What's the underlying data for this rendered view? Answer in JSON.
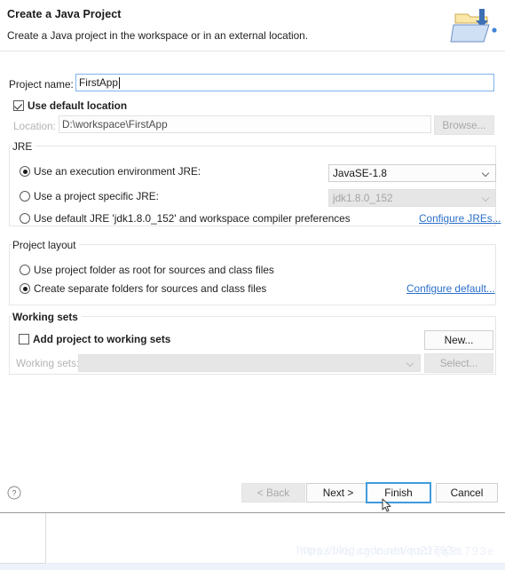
{
  "header": {
    "title": "Create a Java Project",
    "subtitle": "Create a Java project in the workspace or in an external location.",
    "icon": "new-java-project-icon"
  },
  "project": {
    "name_label": "Project name:",
    "name_value": "FirstApp",
    "name_placeholder": "",
    "use_default_location_label": "Use default location",
    "use_default_location_checked": true,
    "location_label": "Location:",
    "location_value": "D:\\workspace\\FirstApp",
    "browse_label": "Browse..."
  },
  "jre": {
    "group_label": "JRE",
    "options": [
      {
        "label": "Use an execution environment JRE:",
        "selected": true
      },
      {
        "label": "Use a project specific JRE:",
        "selected": false
      },
      {
        "label": "Use default JRE 'jdk1.8.0_152' and workspace compiler preferences",
        "selected": false
      }
    ],
    "execution_environment_value": "JavaSE-1.8",
    "project_specific_value": "jdk1.8.0_152",
    "configure_link": "Configure JREs..."
  },
  "project_layout": {
    "group_label": "Project layout",
    "options": [
      {
        "label": "Use project folder as root for sources and class files",
        "selected": false
      },
      {
        "label": "Create separate folders for sources and class files",
        "selected": true
      }
    ],
    "configure_link": "Configure default..."
  },
  "working_sets": {
    "group_label": "Working sets",
    "add_label": "Add project to working sets",
    "add_checked": false,
    "sets_label": "Working sets:",
    "sets_value": "",
    "new_label": "New...",
    "select_label": "Select..."
  },
  "footer": {
    "help_icon": "help-icon",
    "back_label": "< Back",
    "next_label": "Next >",
    "finish_label": "Finish",
    "cancel_label": "Cancel"
  },
  "watermark": {
    "text": "https://blog.csdn.net/qq21793e"
  },
  "colors": {
    "link": "#2a6fc9",
    "focus_ring": "#3f9bdc",
    "input_border": "#7eb4ea",
    "dialog_bg": "#ffffff"
  }
}
